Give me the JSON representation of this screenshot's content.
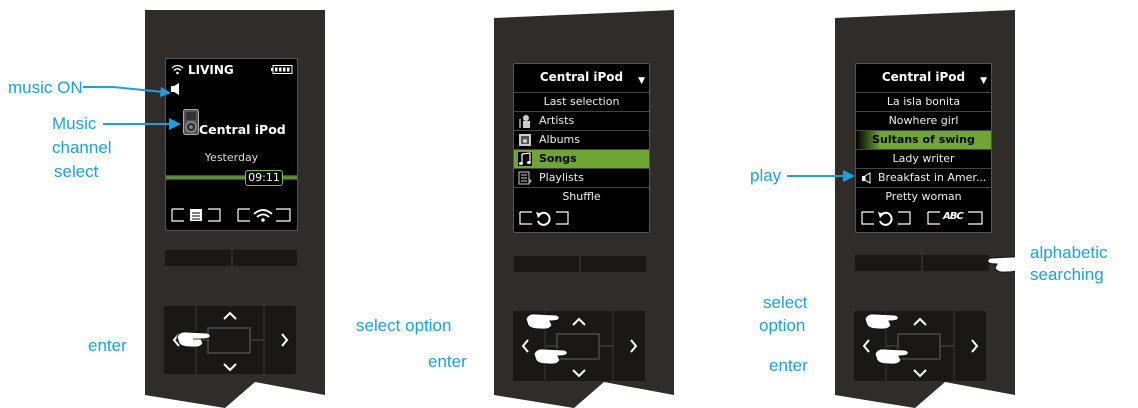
{
  "device1": {
    "room": "LIVING",
    "channel": "Central iPod",
    "subtitle": "Yesterday",
    "time": "09:11"
  },
  "device2": {
    "title": "Central iPod",
    "items": [
      "Last selection",
      "Artists",
      "Albums",
      "Songs",
      "Playlists",
      "Shuffle"
    ],
    "selected": "Songs"
  },
  "device3": {
    "title": "Central iPod",
    "items": [
      "La isla bonita",
      "Nowhere girl",
      "Sultans of swing",
      "Lady writer",
      "Breakfast in Amer...",
      "Pretty woman"
    ],
    "selected": "Sultans of swing",
    "softkey_right": "ABC"
  },
  "callouts": {
    "music_on": "music ON",
    "music_channel_select": [
      "Music",
      "channel",
      "select"
    ],
    "enter": "enter",
    "select_option": "select option",
    "play": "play",
    "alphabetic_searching": [
      "alphabetic",
      "searching"
    ],
    "select_option_stacked": [
      "select",
      "option"
    ]
  },
  "colors": {
    "callout": "#1ea0e0",
    "highlight": "#6ea534",
    "device_body": "#2f2c2a"
  },
  "icons": [
    "wifi-icon",
    "battery-icon",
    "speaker-icon",
    "ipod-icon",
    "artist-icon",
    "album-icon",
    "note-icon",
    "playlist-icon",
    "back-icon",
    "menu-icon",
    "hand-pointer-icon",
    "nav-arrow-icon"
  ]
}
